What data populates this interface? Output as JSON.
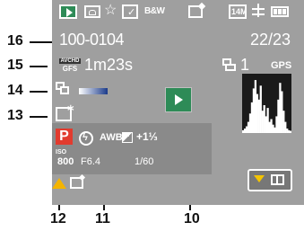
{
  "callouts": {
    "n16": "16",
    "n15": "15",
    "n14": "14",
    "n13": "13",
    "n12": "12",
    "n11": "11",
    "n10": "10"
  },
  "top_bar": {
    "bw_label": "B&W",
    "resolution_label": "14M"
  },
  "playback": {
    "folder_file": "100-0104",
    "counter": "22/23",
    "avchd_label_top": "AVCHD",
    "avchd_label_bottom": "GFS",
    "recording_time": "1m23s",
    "print_count": "1",
    "gps_label": "GPS"
  },
  "info_panel": {
    "mode": "P",
    "awb_label": "AWB",
    "exposure_comp": "+1⅓",
    "iso_label": "ISO",
    "iso_value": "800",
    "aperture": "F6.4",
    "shutter": "1/60"
  },
  "colors": {
    "screen_bg": "#9f9f9f",
    "panel_bg": "#8a8a8a",
    "accent_green": "#2e8b57",
    "accent_red": "#e23b2e",
    "warning_yellow": "#f4b400",
    "button_yellow": "#f4c400"
  },
  "histogram_levels": [
    0.05,
    0.08,
    0.12,
    0.2,
    0.35,
    0.55,
    0.8,
    0.95,
    0.7,
    0.6,
    0.85,
    0.4,
    0.5,
    0.3,
    0.45,
    0.2,
    0.25,
    0.15,
    0.1,
    0.3,
    0.6,
    0.9,
    0.75,
    0.4,
    0.2,
    0.08,
    0.05,
    0.04
  ]
}
